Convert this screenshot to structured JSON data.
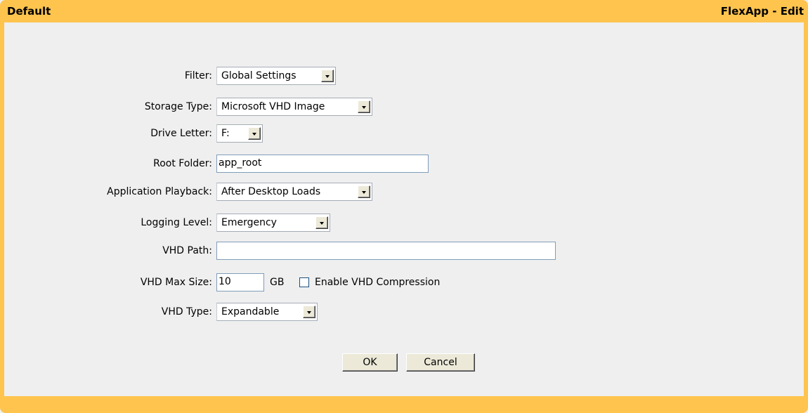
{
  "window": {
    "title_left": "Default",
    "title_right": "FlexApp - Edit"
  },
  "form": {
    "filter": {
      "label": "Filter:",
      "value": "Global Settings"
    },
    "storage_type": {
      "label": "Storage Type:",
      "value": "Microsoft VHD Image"
    },
    "drive_letter": {
      "label": "Drive Letter:",
      "value": "F:"
    },
    "root_folder": {
      "label": "Root Folder:",
      "value": "app_root"
    },
    "application_playback": {
      "label": "Application Playback:",
      "value": "After Desktop Loads"
    },
    "logging_level": {
      "label": "Logging Level:",
      "value": "Emergency"
    },
    "vhd_path": {
      "label": "VHD Path:",
      "value": ""
    },
    "vhd_max_size": {
      "label": "VHD Max Size:",
      "value": "10",
      "unit": "GB"
    },
    "vhd_compression": {
      "label": "Enable VHD Compression",
      "checked": false
    },
    "vhd_type": {
      "label": "VHD Type:",
      "value": "Expandable"
    }
  },
  "buttons": {
    "ok": "OK",
    "cancel": "Cancel"
  },
  "colors": {
    "frame": "#fec44e",
    "background": "#efefef"
  }
}
